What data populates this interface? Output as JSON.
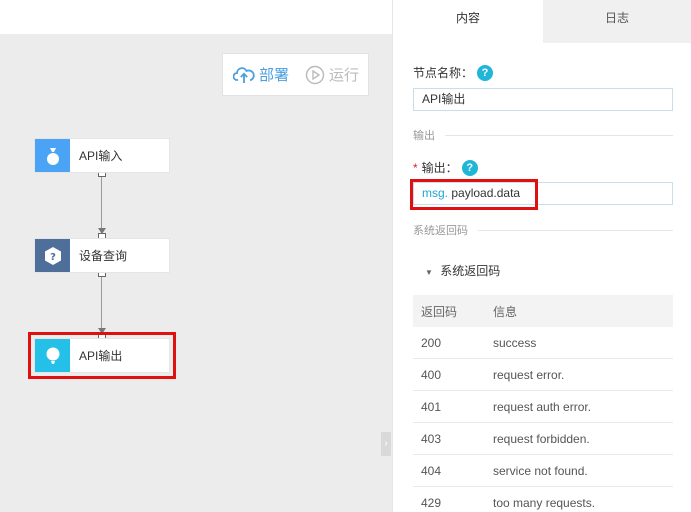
{
  "toolbar": {
    "deploy_label": "部署",
    "run_label": "运行"
  },
  "flow": {
    "nodes": [
      {
        "label": "API输入",
        "icon": "api-input-icon"
      },
      {
        "label": "设备查询",
        "icon": "device-query-icon"
      },
      {
        "label": "API输出",
        "icon": "api-output-icon"
      }
    ]
  },
  "panel": {
    "tabs": [
      {
        "label": "内容"
      },
      {
        "label": "日志"
      }
    ],
    "node_name_label": "节点名称：",
    "node_name_value": "API输出",
    "output_section": "输出",
    "output_label": "输出：",
    "output_prefix": "msg.",
    "output_value": "payload.data",
    "return_section": "系统返回码",
    "return_toggle": "系统返回码",
    "table": {
      "headers": [
        "返回码",
        "信息"
      ],
      "rows": [
        [
          "200",
          "success"
        ],
        [
          "400",
          "request error."
        ],
        [
          "401",
          "request auth error."
        ],
        [
          "403",
          "request forbidden."
        ],
        [
          "404",
          "service not found."
        ],
        [
          "429",
          "too many requests."
        ]
      ]
    }
  },
  "colors": {
    "accent": "#1fb6d8",
    "highlight": "#e01010",
    "deploy": "#4a9fe0"
  }
}
